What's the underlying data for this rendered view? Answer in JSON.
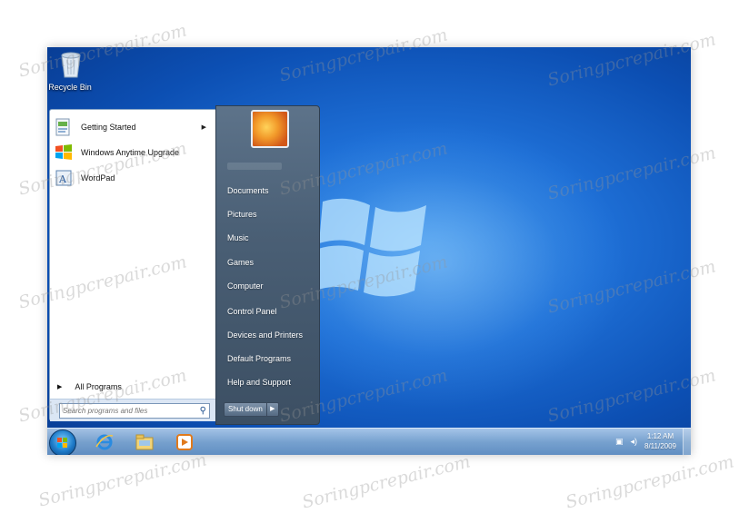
{
  "desktop": {
    "recycle_bin_label": "Recycle Bin"
  },
  "start_menu": {
    "programs": [
      {
        "label": "Getting Started",
        "icon": "getting-started-icon",
        "has_submenu": true
      },
      {
        "label": "Windows Anytime Upgrade",
        "icon": "windows-flag-icon",
        "has_submenu": false
      },
      {
        "label": "WordPad",
        "icon": "wordpad-icon",
        "has_submenu": false
      }
    ],
    "all_programs_label": "All Programs",
    "search_placeholder": "Search programs and files",
    "right_items": [
      "Documents",
      "Pictures",
      "Music",
      "Games",
      "Computer",
      "Control Panel",
      "Devices and Printers",
      "Default Programs",
      "Help and Support"
    ],
    "shutdown_label": "Shut down"
  },
  "taskbar": {
    "apps": [
      "internet-explorer-icon",
      "windows-explorer-icon",
      "media-player-icon"
    ],
    "time": "1:12 AM",
    "date": "8/11/2009"
  },
  "watermark": "Soringpcrepair.com",
  "colors": {
    "desktop_blue": "#1e6fd6",
    "start_right_pane": "#4a5f75",
    "taskbar": "#82aad2"
  }
}
